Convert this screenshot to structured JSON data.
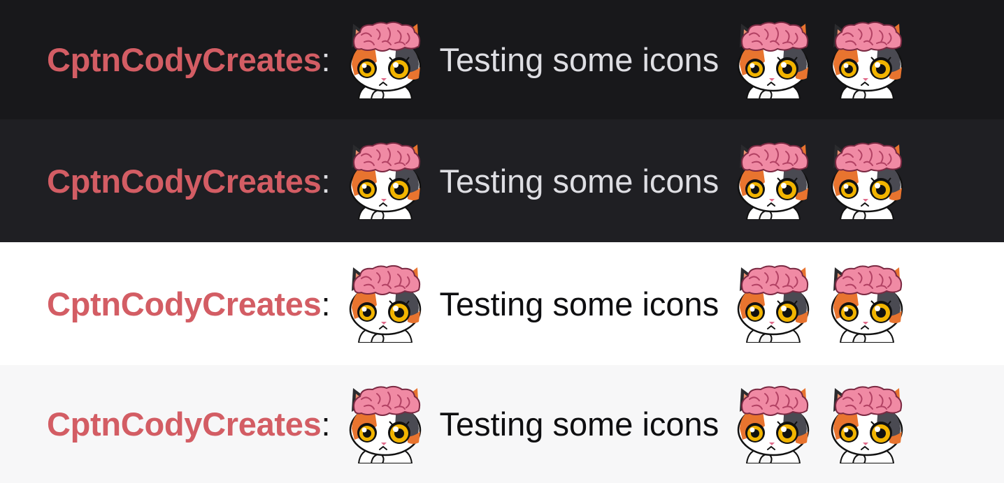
{
  "rows": [
    {
      "theme": "dark",
      "background": "#18181b",
      "username": "CptnCodyCreates",
      "separator": ":",
      "message": "Testing some icons",
      "text_color": "#dedee3"
    },
    {
      "theme": "dark-alt",
      "background": "#1f1f23",
      "username": "CptnCodyCreates",
      "separator": ":",
      "message": "Testing some icons",
      "text_color": "#dedee3"
    },
    {
      "theme": "light",
      "background": "#ffffff",
      "username": "CptnCodyCreates",
      "separator": ":",
      "message": "Testing some icons",
      "text_color": "#0e0e10"
    },
    {
      "theme": "light-alt",
      "background": "#f7f7f8",
      "username": "CptnCodyCreates",
      "separator": ":",
      "message": "Testing some icons",
      "text_color": "#0e0e10"
    }
  ],
  "username_color": "#d35d64",
  "emote": {
    "name": "brain-cat-emote-icon"
  }
}
